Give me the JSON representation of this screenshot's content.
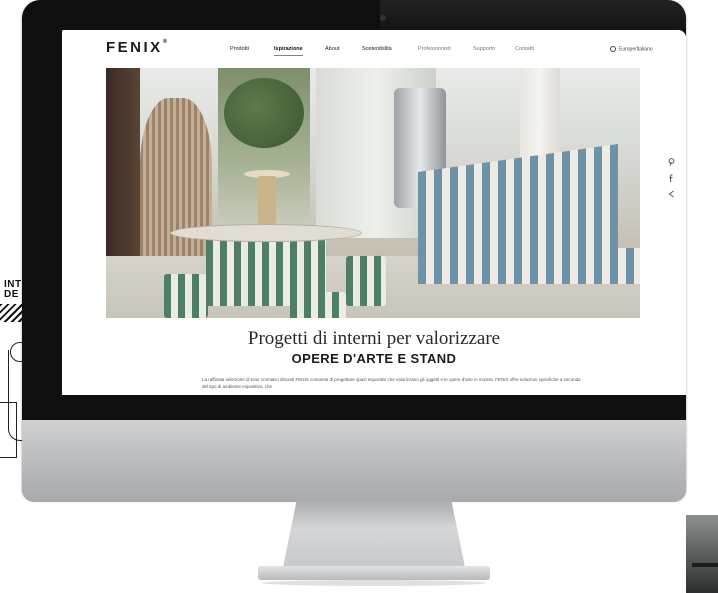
{
  "background": {
    "left_card_title_lines": [
      "INT",
      "DE"
    ]
  },
  "site": {
    "logo": "FENIX",
    "logo_mark": "®",
    "nav": [
      {
        "label": "Prodotti",
        "active": false
      },
      {
        "label": "Ispirazione",
        "active": true
      },
      {
        "label": "About",
        "active": false
      },
      {
        "label": "Sostenibilità",
        "active": false
      },
      {
        "label": "Professionisti",
        "active": false
      },
      {
        "label": "Supporto",
        "active": false
      },
      {
        "label": "Contatti",
        "active": false
      }
    ],
    "language": "Europe/Italiano",
    "side_icons": [
      "pinterest-icon",
      "facebook-icon",
      "share-icon"
    ],
    "headline": "Progetti di interni per valorizzare",
    "subheadline": "OPERE D'ARTE E STAND",
    "body": "La raffinata selezione di tone cromatici discreti FENIX consente di progettare spazi espositivi che valorizzano gli oggetti e le opere d'arte in mostra. FENIX offre soluzioni specifiche a seconda del tipo di ambiente espositivo, che"
  },
  "colors": {
    "bezel": "#0f0f10",
    "chin": "#b7b9bc",
    "stripe_green": "#4f7e64",
    "stripe_blue": "#6f93a4"
  }
}
